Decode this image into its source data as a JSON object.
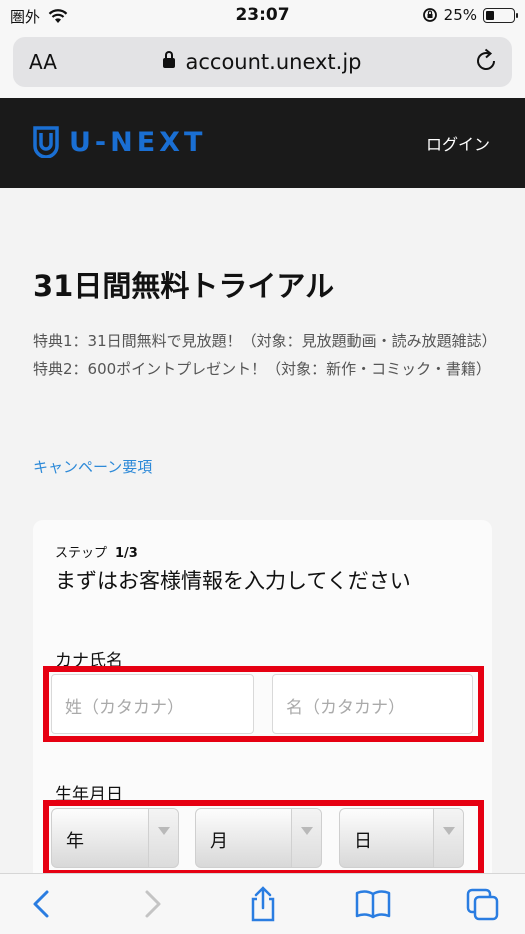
{
  "status_bar": {
    "carrier": "圏外",
    "time": "23:07",
    "battery_percent": "25%",
    "battery_level": 0.25
  },
  "browser": {
    "text_size_label": "AA",
    "url": "account.unext.jp"
  },
  "header": {
    "logo_text": "U-NEXT",
    "login_label": "ログイン"
  },
  "page": {
    "title": "31日間無料トライアル",
    "benefit_1": "特典1：31日間無料で見放題！（対象：見放題動画・読み放題雑誌）",
    "benefit_2": "特典2：600ポイントプレゼント！（対象：新作・コミック・書籍）",
    "campaign_link": "キャンペーン要項"
  },
  "form": {
    "step_label": "ステップ",
    "step_value": "1/3",
    "heading": "まずはお客様情報を入力してください",
    "kana_label": "カナ氏名",
    "last_name_placeholder": "姓（カタカナ）",
    "first_name_placeholder": "名（カタカナ）",
    "dob_label": "生年月日",
    "year_option": "年",
    "month_option": "月",
    "day_option": "日"
  },
  "colors": {
    "brand_blue": "#1a6fd3",
    "header_bg": "#1a1a1a",
    "link_blue": "#2e8ad8",
    "highlight_red": "#e60012",
    "safari_blue": "#2a7de1"
  },
  "icons": {
    "wifi": "wifi-icon",
    "orientation_lock": "orientation-lock-icon",
    "lock": "lock-icon",
    "reload": "reload-icon",
    "back": "chevron-left-icon",
    "forward": "chevron-right-icon",
    "share": "share-icon",
    "bookmarks": "book-icon",
    "tabs": "tabs-icon"
  }
}
